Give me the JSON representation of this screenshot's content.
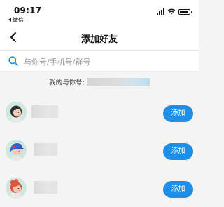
{
  "status_bar": {
    "time": "09:17",
    "back_app": "微信"
  },
  "nav": {
    "title": "添加好友",
    "back_icon": "chevron-left-icon"
  },
  "search": {
    "placeholder": "与你号/手机号/群号",
    "icon": "search-icon"
  },
  "my_id": {
    "label": "我的与你号:"
  },
  "friends": [
    {
      "add_label": "添加",
      "avatar": "avatar-girl-dark-hair"
    },
    {
      "add_label": "添加",
      "avatar": "avatar-boy-blue-cap"
    },
    {
      "add_label": "添加",
      "avatar": "avatar-girl-red-hair"
    }
  ],
  "colors": {
    "accent": "#1d8fe8",
    "background": "#f4f4f4",
    "avatar_bg": "#cfe8df"
  }
}
